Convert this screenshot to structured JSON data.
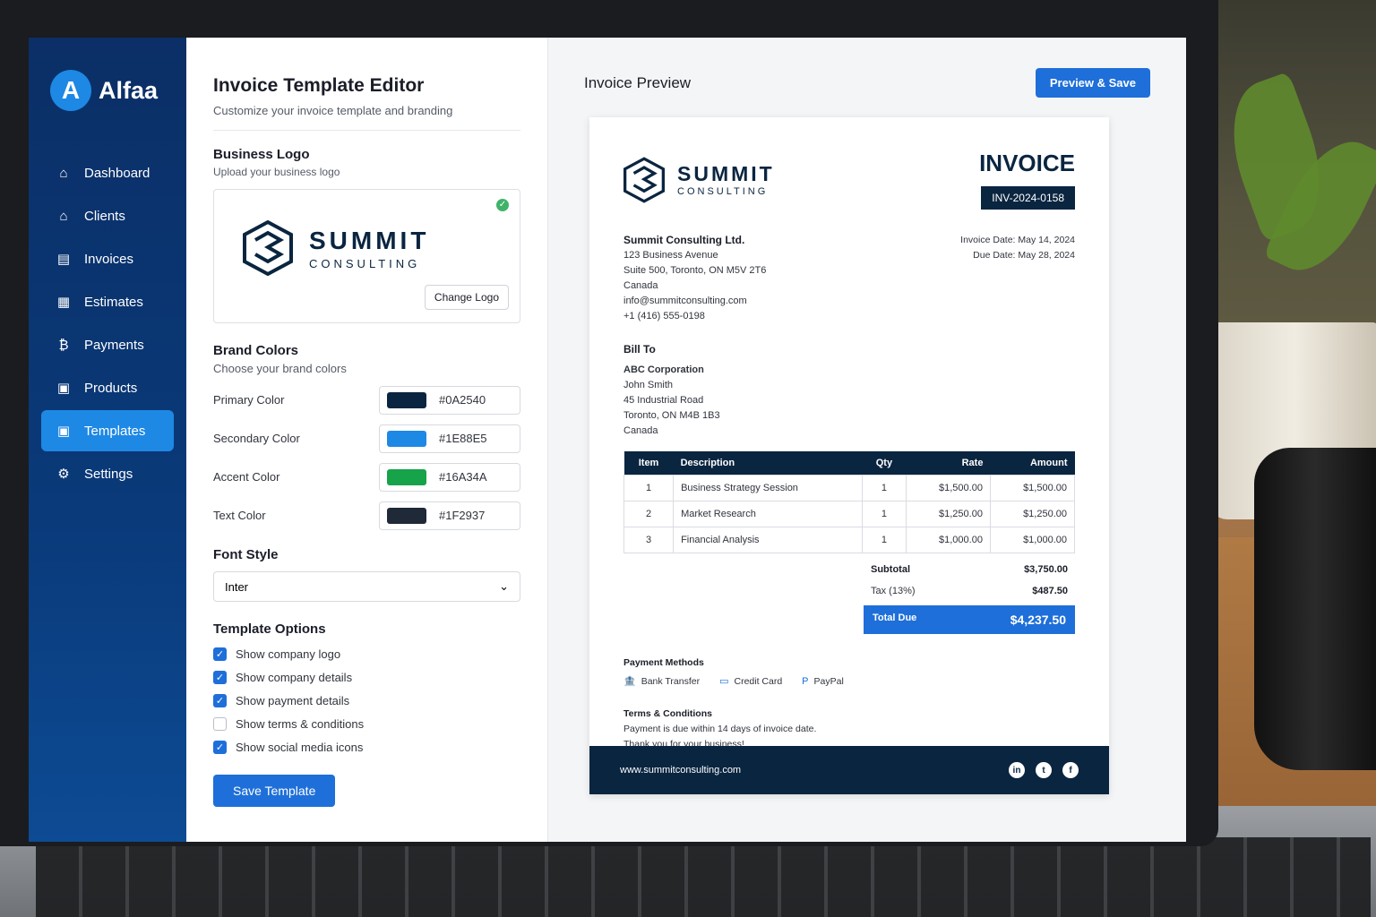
{
  "app": {
    "brand_name": "Alfaa",
    "brand_initial": "A"
  },
  "sidebar": {
    "items": [
      {
        "label": "Dashboard",
        "icon": "home-icon",
        "glyph": "⌂"
      },
      {
        "label": "Clients",
        "icon": "clients-icon",
        "glyph": "⌂"
      },
      {
        "label": "Invoices",
        "icon": "invoice-icon",
        "glyph": "▤"
      },
      {
        "label": "Estimates",
        "icon": "estimate-icon",
        "glyph": "▦"
      },
      {
        "label": "Payments",
        "icon": "payment-icon",
        "glyph": "₿"
      },
      {
        "label": "Products",
        "icon": "products-icon",
        "glyph": "▣"
      },
      {
        "label": "Templates",
        "icon": "templates-icon",
        "glyph": "▣",
        "active": true
      },
      {
        "label": "Settings",
        "icon": "gear-icon",
        "glyph": "⚙"
      }
    ]
  },
  "editor": {
    "title": "Invoice Template Editor",
    "subtitle": "Customize your invoice template and branding",
    "logo_section": {
      "title": "Business Logo",
      "subtitle": "Upload your business logo",
      "change_label": "Change Logo"
    },
    "logo": {
      "name": "SUMMIT",
      "tagline": "CONSULTING"
    },
    "colors": {
      "title": "Brand Colors",
      "subtitle": "Choose your brand colors",
      "items": [
        {
          "label": "Primary Color",
          "value": "#0A2540",
          "swatch": "#0A2540"
        },
        {
          "label": "Secondary Color",
          "value": "#1E88E5",
          "swatch": "#1E88E5"
        },
        {
          "label": "Accent Color",
          "value": "#16A34A",
          "swatch": "#16A34A"
        },
        {
          "label": "Text Color",
          "value": "#1F2937",
          "swatch": "#1F2937"
        }
      ]
    },
    "font": {
      "title": "Font Style",
      "value": "Inter"
    },
    "options": {
      "title": "Template Options",
      "items": [
        {
          "label": "Show company logo",
          "checked": true
        },
        {
          "label": "Show company details",
          "checked": true
        },
        {
          "label": "Show payment details",
          "checked": true
        },
        {
          "label": "Show terms & conditions",
          "checked": false
        },
        {
          "label": "Show social media icons",
          "checked": true
        }
      ]
    },
    "save_label": "Save Template"
  },
  "preview": {
    "title": "Invoice Preview",
    "save_label": "Preview & Save",
    "invoice": {
      "logo_name": "SUMMIT",
      "logo_tagline": "CONSULTING",
      "heading": "INVOICE",
      "number": "INV-2024-0158",
      "company": {
        "name": "Summit Consulting Ltd.",
        "lines": [
          "123 Business Avenue",
          "Suite 500, Toronto, ON M5V 2T6",
          "Canada",
          "info@summitconsulting.com",
          "+1 (416) 555-0198"
        ]
      },
      "invoice_date": "Invoice Date: May 14, 2024",
      "due_date": "Due Date: May 28, 2024",
      "bill_to": {
        "label": "Bill To",
        "name": "ABC Corporation",
        "lines": [
          "John Smith",
          "45 Industrial Road",
          "Toronto, ON M4B 1B3",
          "Canada"
        ]
      },
      "table": {
        "headers": [
          "Item",
          "Description",
          "Qty",
          "Rate",
          "Amount"
        ],
        "rows": [
          [
            "1",
            "Business Strategy Session",
            "1",
            "$1,500.00",
            "$1,500.00"
          ],
          [
            "2",
            "Market Research",
            "1",
            "$1,250.00",
            "$1,250.00"
          ],
          [
            "3",
            "Financial Analysis",
            "1",
            "$1,000.00",
            "$1,000.00"
          ]
        ]
      },
      "subtotal_label": "Subtotal",
      "subtotal": "$3,750.00",
      "tax_label": "Tax (13%)",
      "tax": "$487.50",
      "total_label": "Total Due",
      "total": "$4,237.50",
      "payment": {
        "label": "Payment Methods",
        "methods": [
          {
            "label": "Bank Transfer",
            "icon": "bank-icon",
            "glyph": "🏦"
          },
          {
            "label": "Credit Card",
            "icon": "credit-card-icon",
            "glyph": "▭"
          },
          {
            "label": "PayPal",
            "icon": "paypal-icon",
            "glyph": "P"
          }
        ]
      },
      "terms": {
        "label": "Terms & Conditions",
        "lines": [
          "Payment is due within 14 days of invoice date.",
          "Thank you for your business!"
        ]
      },
      "website": "www.summitconsulting.com",
      "social": [
        {
          "icon": "linkedin-icon",
          "glyph": "in"
        },
        {
          "icon": "twitter-icon",
          "glyph": "t"
        },
        {
          "icon": "facebook-icon",
          "glyph": "f"
        }
      ]
    }
  }
}
